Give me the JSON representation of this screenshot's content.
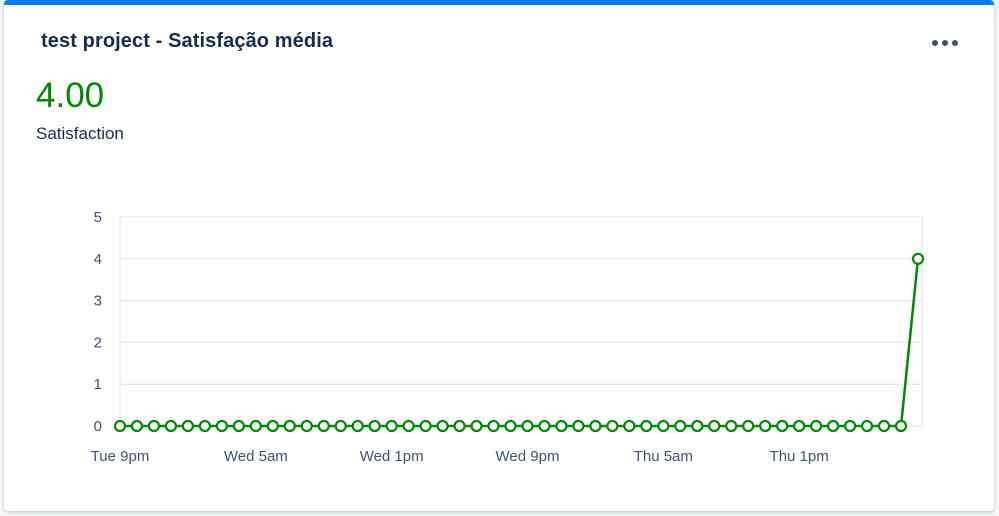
{
  "widget": {
    "title": "test project - Satisfação média",
    "value": "4.00",
    "metric_label": "Satisfaction",
    "menu_icon": "more-horizontal-icon",
    "accent_color": "#0c7be8",
    "value_color": "#008a00"
  },
  "chart_data": {
    "type": "line",
    "title": "",
    "xlabel": "",
    "ylabel": "",
    "ylim": [
      0,
      5
    ],
    "yticks": [
      "0",
      "1",
      "2",
      "3",
      "4",
      "5"
    ],
    "xtick_labels": [
      "Tue 9pm",
      "Wed 5am",
      "Wed 1pm",
      "Wed 9pm",
      "Thu 5am",
      "Thu 1pm"
    ],
    "xtick_indices": [
      0,
      8,
      16,
      24,
      32,
      40
    ],
    "grid": true,
    "series": [
      {
        "color": "#008a00",
        "values": [
          0,
          0,
          0,
          0,
          0,
          0,
          0,
          0,
          0,
          0,
          0,
          0,
          0,
          0,
          0,
          0,
          0,
          0,
          0,
          0,
          0,
          0,
          0,
          0,
          0,
          0,
          0,
          0,
          0,
          0,
          0,
          0,
          0,
          0,
          0,
          0,
          0,
          0,
          0,
          0,
          0,
          0,
          0,
          0,
          0,
          0,
          0,
          4
        ]
      }
    ]
  }
}
